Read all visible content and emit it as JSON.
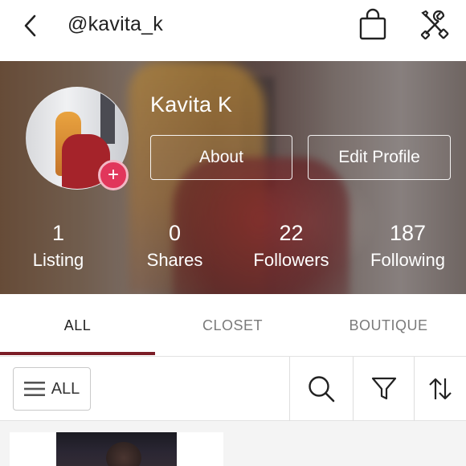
{
  "topbar": {
    "username": "@kavita_k",
    "back_icon": "chevron-left-icon",
    "bag_icon": "shopping-bag-icon",
    "tools_icon": "tools-icon"
  },
  "profile": {
    "display_name": "Kavita K",
    "about_label": "About",
    "edit_profile_label": "Edit Profile",
    "add_photo_symbol": "+"
  },
  "stats": [
    {
      "value": "1",
      "label": "Listing"
    },
    {
      "value": "0",
      "label": "Shares"
    },
    {
      "value": "22",
      "label": "Followers"
    },
    {
      "value": "187",
      "label": "Following"
    }
  ],
  "tabs": [
    {
      "label": "ALL",
      "active": true
    },
    {
      "label": "CLOSET",
      "active": false
    },
    {
      "label": "BOUTIQUE",
      "active": false
    }
  ],
  "filterbar": {
    "all_label": "ALL",
    "menu_icon": "hamburger-icon",
    "search_icon": "search-icon",
    "filter_icon": "filter-icon",
    "sort_icon": "sort-icon"
  },
  "colors": {
    "accent": "#7b1d27",
    "add_badge": "#e1365b",
    "text": "#222222",
    "muted": "#7a7a7a"
  }
}
